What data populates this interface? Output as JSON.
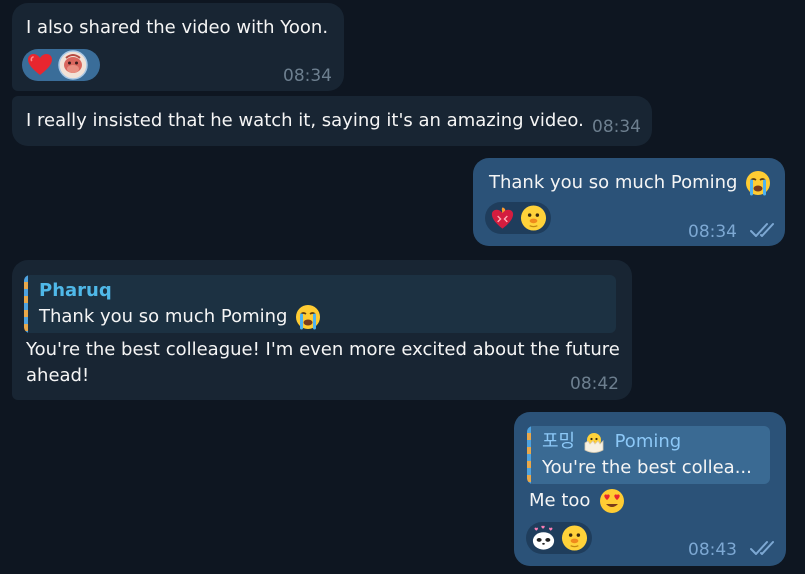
{
  "messages": [
    {
      "direction": "incoming",
      "text": "I also shared the video with Yoon.",
      "time": "08:34",
      "reactions": [
        "heart-emoji",
        "user-avatar-reaction"
      ]
    },
    {
      "direction": "incoming",
      "text": "I really insisted that he watch it, saying it's an amazing video.",
      "time": "08:34"
    },
    {
      "direction": "outgoing",
      "text": "Thank you so much Poming",
      "text_emoji": "crying-face-emoji",
      "time": "08:34",
      "read": true,
      "reactions": [
        "heart-on-fire-emoji",
        "duck-emoji"
      ]
    },
    {
      "direction": "incoming",
      "reply": {
        "name": "Pharuq",
        "text": "Thank you so much Poming",
        "text_emoji": "crying-face-emoji"
      },
      "text_line1": "You're the best colleague! I'm even more excited about the future",
      "text_line2": "ahead!",
      "time": "08:42"
    },
    {
      "direction": "outgoing",
      "reply": {
        "name_prefix": "포밍",
        "name_emoji": "hatching-chick-emoji",
        "name": "Poming",
        "text": "You're the best collea..."
      },
      "text": "Me too",
      "text_emoji": "heart-eyes-emoji",
      "time": "08:43",
      "read": true,
      "reactions": [
        "panda-hearts-emoji",
        "duck-emoji"
      ]
    }
  ],
  "colors": {
    "background": "#0e1621",
    "incoming_bubble": "#182533",
    "outgoing_bubble": "#2b5278",
    "reply_name_incoming": "#4fb8e8",
    "reply_name_outgoing": "#8cc8f7",
    "read_checks": "#7da8d3"
  }
}
